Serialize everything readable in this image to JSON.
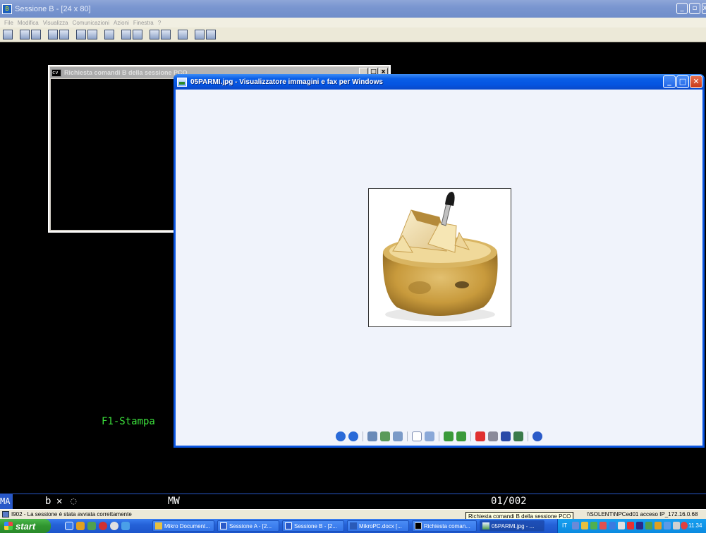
{
  "emulator": {
    "title": "Sessione B - [24 x 80]",
    "menu": [
      "File",
      "Modifica",
      "Visualizza",
      "Comunicazioni",
      "Azioni",
      "Finestra",
      "?"
    ],
    "terminal_f1": "F1-Stampa",
    "oia": {
      "mode": "MA",
      "session": "b",
      "mw": "MW",
      "position": "01/002"
    },
    "status_message": "I902 - La sessione è stata avviata correttamente",
    "status_right": "\\\\SOLENT\\NPCed01 acceso IP_172.16.0.68",
    "tooltip": "Richiesta comandi B della sessione PCO"
  },
  "command_window": {
    "title": "Richiesta comandi B della sessione PCO"
  },
  "viewer": {
    "title": "05PARMI.jpg - Visualizzatore immagini e fax per Windows",
    "image_subject": "Parmigiano cheese wheel with knife"
  },
  "taskbar": {
    "start_label": "start",
    "buttons": [
      "Mikro Document...",
      "Sessione A - [2...",
      "Sessione B - [2...",
      "MikroPC.docx [...",
      "Richiesta coman...",
      "05PARMI.jpg - ..."
    ],
    "tray_lang": "IT",
    "clock": "11.34"
  }
}
